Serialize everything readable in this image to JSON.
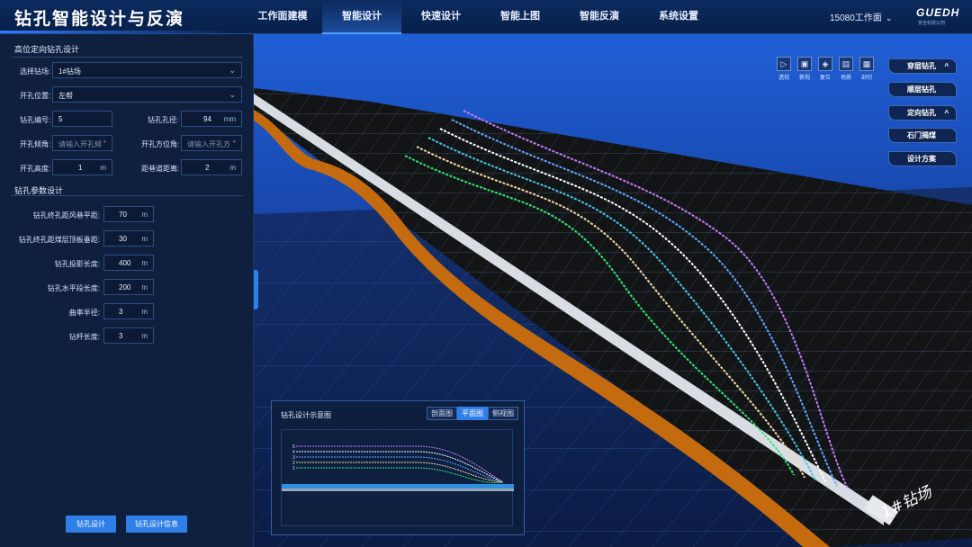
{
  "header": {
    "app_title": "钻孔智能设计与反演",
    "nav": [
      "工作面建模",
      "智能设计",
      "快速设计",
      "智能上图",
      "智能反演",
      "系统设置"
    ],
    "active_nav": 1,
    "workspace": "15080工作面",
    "logo": "GUEDH",
    "logo_sub": "安全科技公司"
  },
  "left_panel": {
    "section1_title": "高位定向钻孔设计",
    "select_field_label": "选择钻场:",
    "select_field_value": "1#钻场",
    "open_pos_label": "开孔位置:",
    "open_pos_value": "左帮",
    "hole_no_label": "钻孔编号:",
    "hole_no_value": "5",
    "hole_dia_label": "钻孔孔径:",
    "hole_dia_value": "94",
    "hole_dia_unit": "mm",
    "open_incl_label": "开孔倾角:",
    "open_incl_placeholder": "请输入开孔倾",
    "open_azim_label": "开孔方位角:",
    "open_azim_placeholder": "请输入开孔方",
    "deg_unit": "°",
    "open_height_label": "开孔高度:",
    "open_height_value": "1",
    "dist_label": "距巷道距离:",
    "dist_value": "2",
    "m_unit": "m",
    "section2_title": "钻孔参数设计",
    "params": [
      {
        "label": "钻孔终孔距风巷平距:",
        "value": "70",
        "unit": "m"
      },
      {
        "label": "钻孔终孔距煤层顶板垂距:",
        "value": "30",
        "unit": "m"
      },
      {
        "label": "钻孔投影长度:",
        "value": "400",
        "unit": "m"
      },
      {
        "label": "钻孔水平段长度:",
        "value": "200",
        "unit": "m"
      },
      {
        "label": "曲率半径:",
        "value": "3",
        "unit": "m"
      },
      {
        "label": "钻杆长度:",
        "value": "3",
        "unit": "m"
      }
    ],
    "btn_design": "钻孔设计",
    "btn_info": "钻孔设计信息"
  },
  "toolbar": {
    "tools": [
      {
        "label": "透视",
        "icon": "perspective-icon"
      },
      {
        "label": "俯视",
        "icon": "top-view-icon"
      },
      {
        "label": "复位",
        "icon": "reset-icon"
      },
      {
        "label": "地质",
        "icon": "geology-icon"
      },
      {
        "label": "剖切",
        "icon": "section-icon"
      }
    ]
  },
  "right_buttons": [
    {
      "label": "穿层钻孔",
      "chevron": "^"
    },
    {
      "label": "顺层钻孔",
      "chevron": ""
    },
    {
      "label": "定向钻孔",
      "chevron": "^"
    },
    {
      "label": "石门揭煤",
      "chevron": ""
    },
    {
      "label": "设计方案",
      "chevron": ""
    }
  ],
  "scene": {
    "site_label": "1#钻场",
    "hole_colors": [
      "#39e27a",
      "#f5d9a4",
      "#49c6e6",
      "#ffffff",
      "#62a8ff",
      "#c77dff"
    ]
  },
  "schematic": {
    "title": "钻孔设计示意图",
    "tabs": [
      "剖面图",
      "平面图",
      "侧视图"
    ],
    "active_tab": 1,
    "hole_labels": [
      "5",
      "4",
      "3",
      "2",
      "1"
    ]
  }
}
